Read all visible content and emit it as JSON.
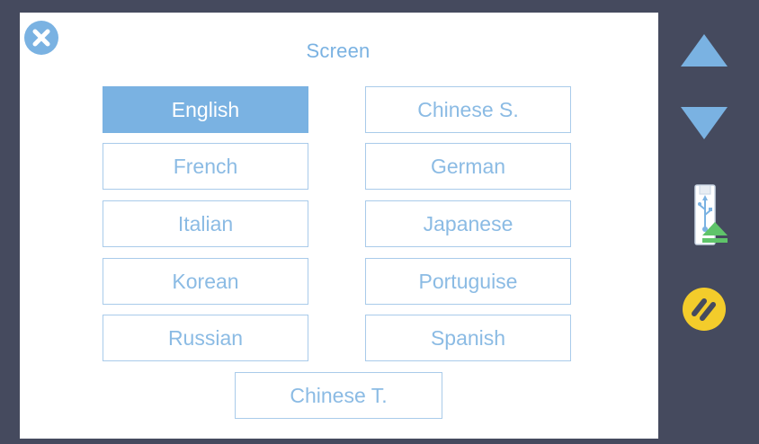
{
  "dialog": {
    "title": "Screen",
    "close_icon": "close-icon"
  },
  "languages": [
    {
      "label": "English",
      "selected": true
    },
    {
      "label": "Chinese S.",
      "selected": false
    },
    {
      "label": "French",
      "selected": false
    },
    {
      "label": "German",
      "selected": false
    },
    {
      "label": "Italian",
      "selected": false
    },
    {
      "label": "Japanese",
      "selected": false
    },
    {
      "label": "Korean",
      "selected": false
    },
    {
      "label": "Portuguise",
      "selected": false
    },
    {
      "label": "Russian",
      "selected": false
    },
    {
      "label": "Spanish",
      "selected": false
    },
    {
      "label": "Chinese T.",
      "selected": false
    }
  ],
  "sidebar": {
    "buttons": [
      {
        "icon": "arrow-up-icon"
      },
      {
        "icon": "arrow-down-icon"
      },
      {
        "icon": "usb-eject-icon"
      },
      {
        "icon": "pause-icon"
      }
    ]
  },
  "colors": {
    "accent": "#7ab2e2",
    "border": "#a9cbea",
    "background": "#454a5e",
    "pause_yellow": "#f3cc2b",
    "usb_green": "#5fc46a"
  }
}
